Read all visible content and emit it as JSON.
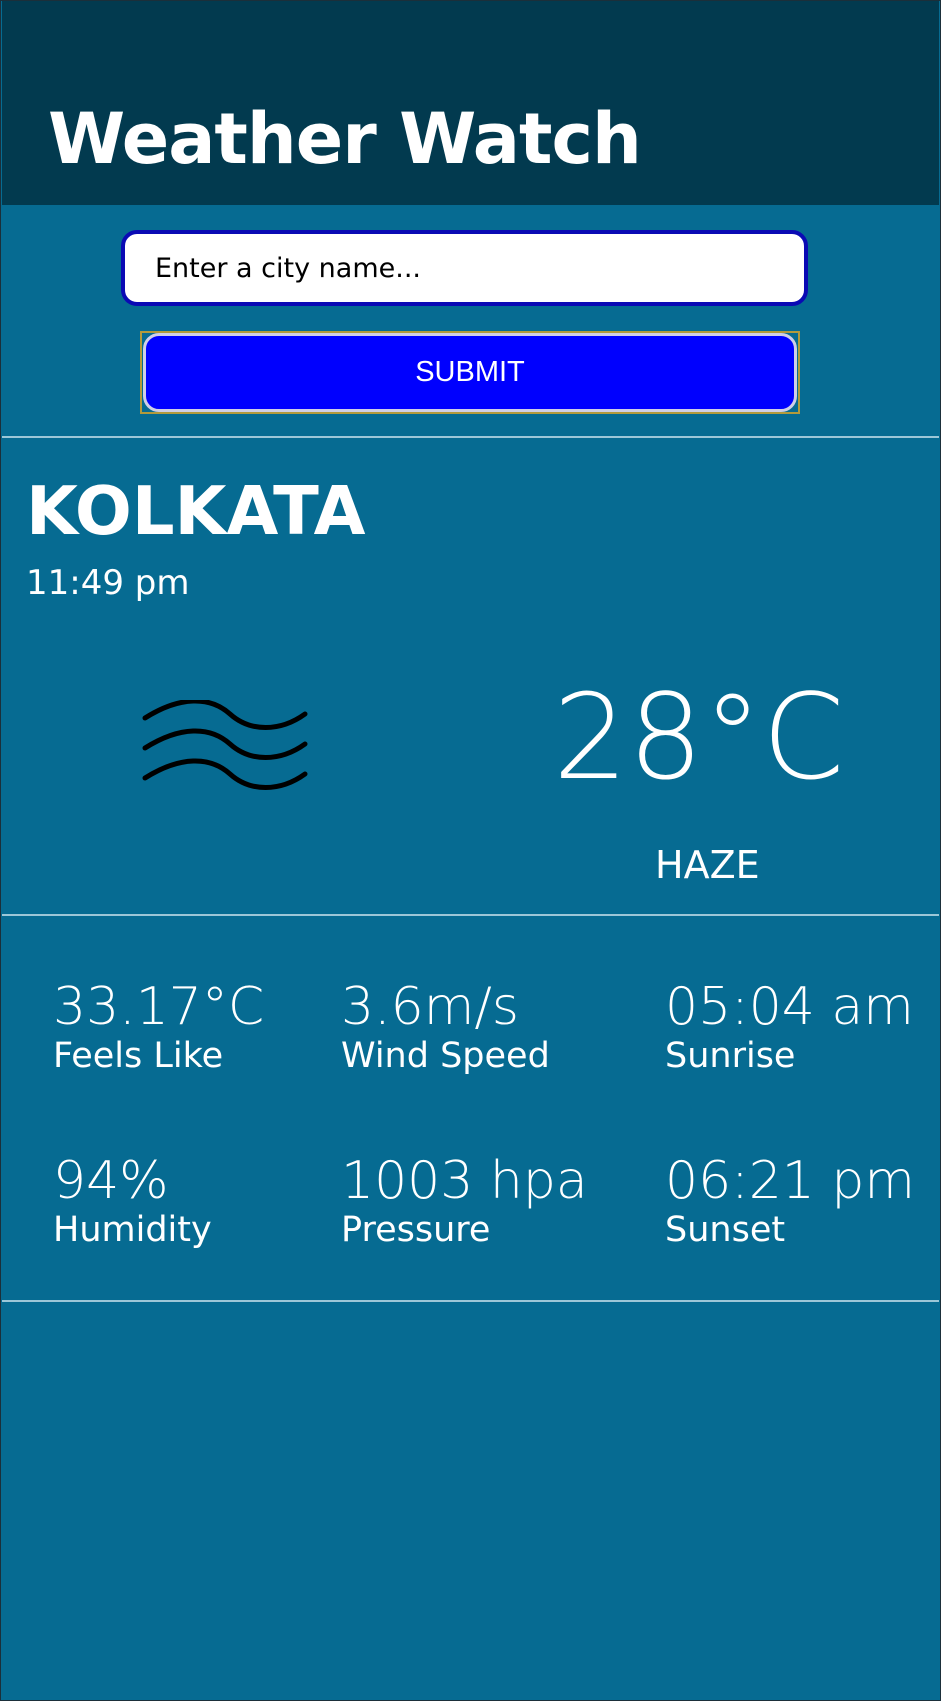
{
  "header": {
    "title": "Weather Watch"
  },
  "search": {
    "placeholder": "Enter a city name...",
    "submit_label": "SUBMIT"
  },
  "current": {
    "city": "KOLKATA",
    "time": "11:49 pm",
    "temperature": "28°C",
    "condition": "HAZE",
    "icon": "haze-waves-icon"
  },
  "stats": {
    "feels_like": {
      "value": "33.17°C",
      "label": "Feels Like"
    },
    "wind_speed": {
      "value": "3.6m/s",
      "label": "Wind Speed"
    },
    "sunrise": {
      "value": "05:04 am",
      "label": "Sunrise"
    },
    "humidity": {
      "value": "94%",
      "label": "Humidity"
    },
    "pressure": {
      "value": "1003 hpa",
      "label": "Pressure"
    },
    "sunset": {
      "value": "06:21 pm",
      "label": "Sunset"
    }
  },
  "colors": {
    "header_bg": "#023a4f",
    "page_bg": "#066b92",
    "button_bg": "#0000fe",
    "input_border": "#0a0ab4"
  }
}
